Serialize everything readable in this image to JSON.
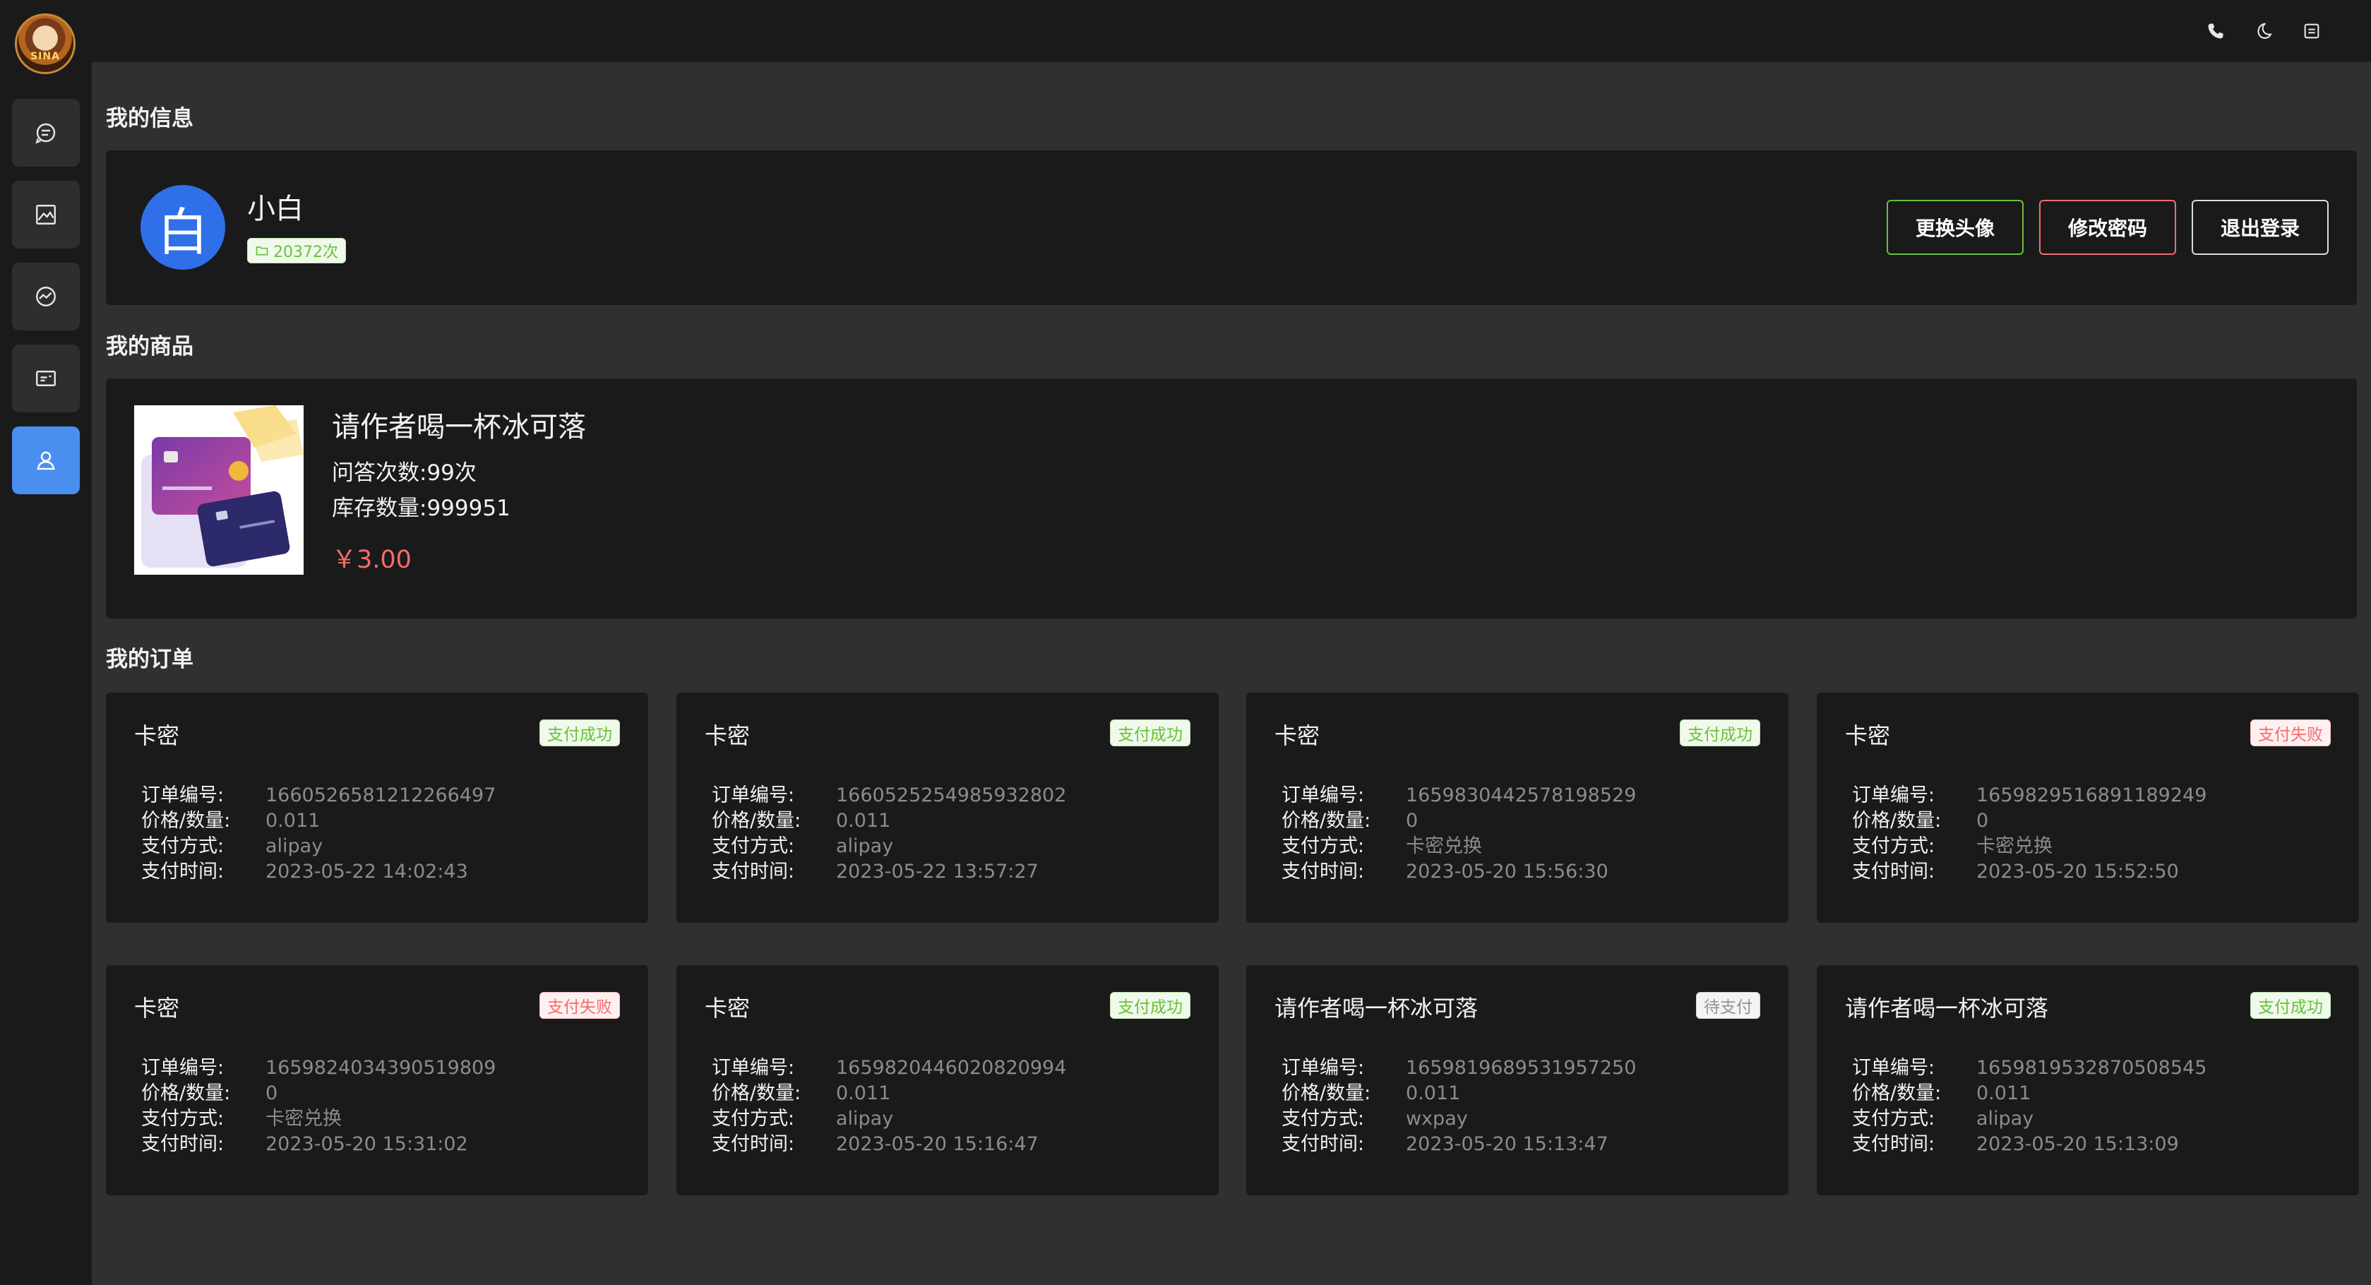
{
  "app": {
    "logo_text": "SINA"
  },
  "sidebar": {
    "items": [
      {
        "icon": "chat-icon"
      },
      {
        "icon": "image-icon"
      },
      {
        "icon": "mindmap-icon"
      },
      {
        "icon": "card-icon"
      },
      {
        "icon": "user-icon",
        "active": true
      }
    ]
  },
  "topbar": {
    "icons": [
      "phone-icon",
      "moon-icon",
      "fullscreen-icon"
    ]
  },
  "profile": {
    "section_title": "我的信息",
    "avatar_char": "白",
    "username": "小白",
    "count": "20372次",
    "buttons": {
      "change_avatar": "更换头像",
      "change_password": "修改密码",
      "logout": "退出登录"
    }
  },
  "products": {
    "section_title": "我的商品",
    "item": {
      "name": "请作者喝一杯冰可落",
      "qa_label": "问答次数:",
      "qa_value": "99次",
      "stock_label": "库存数量:",
      "stock_value": "999951",
      "price": "￥3.00"
    }
  },
  "orders": {
    "section_title": "我的订单",
    "labels": {
      "order_no": "订单编号:",
      "price_qty": "价格/数量:",
      "pay_method": "支付方式:",
      "pay_time": "支付时间:"
    },
    "list": [
      {
        "title": "卡密",
        "status": "支付成功",
        "status_type": "success",
        "order_no": "1660526581212266497",
        "price_qty": "0.011",
        "pay_method": "alipay",
        "pay_time": "2023-05-22 14:02:43"
      },
      {
        "title": "卡密",
        "status": "支付成功",
        "status_type": "success",
        "order_no": "1660525254985932802",
        "price_qty": "0.011",
        "pay_method": "alipay",
        "pay_time": "2023-05-22 13:57:27"
      },
      {
        "title": "卡密",
        "status": "支付成功",
        "status_type": "success",
        "order_no": "1659830442578198529",
        "price_qty": "0",
        "pay_method": "卡密兑换",
        "pay_time": "2023-05-20 15:56:30"
      },
      {
        "title": "卡密",
        "status": "支付失败",
        "status_type": "fail",
        "order_no": "1659829516891189249",
        "price_qty": "0",
        "pay_method": "卡密兑换",
        "pay_time": "2023-05-20 15:52:50"
      },
      {
        "title": "卡密",
        "status": "支付失败",
        "status_type": "fail",
        "order_no": "1659824034390519809",
        "price_qty": "0",
        "pay_method": "卡密兑换",
        "pay_time": "2023-05-20 15:31:02"
      },
      {
        "title": "卡密",
        "status": "支付成功",
        "status_type": "success",
        "order_no": "1659820446020820994",
        "price_qty": "0.011",
        "pay_method": "alipay",
        "pay_time": "2023-05-20 15:16:47"
      },
      {
        "title": "请作者喝一杯冰可落",
        "status": "待支付",
        "status_type": "pending",
        "order_no": "1659819689531957250",
        "price_qty": "0.011",
        "pay_method": "wxpay",
        "pay_time": "2023-05-20 15:13:47"
      },
      {
        "title": "请作者喝一杯冰可落",
        "status": "支付成功",
        "status_type": "success",
        "order_no": "1659819532870508545",
        "price_qty": "0.011",
        "pay_method": "alipay",
        "pay_time": "2023-05-20 15:13:09"
      }
    ]
  }
}
